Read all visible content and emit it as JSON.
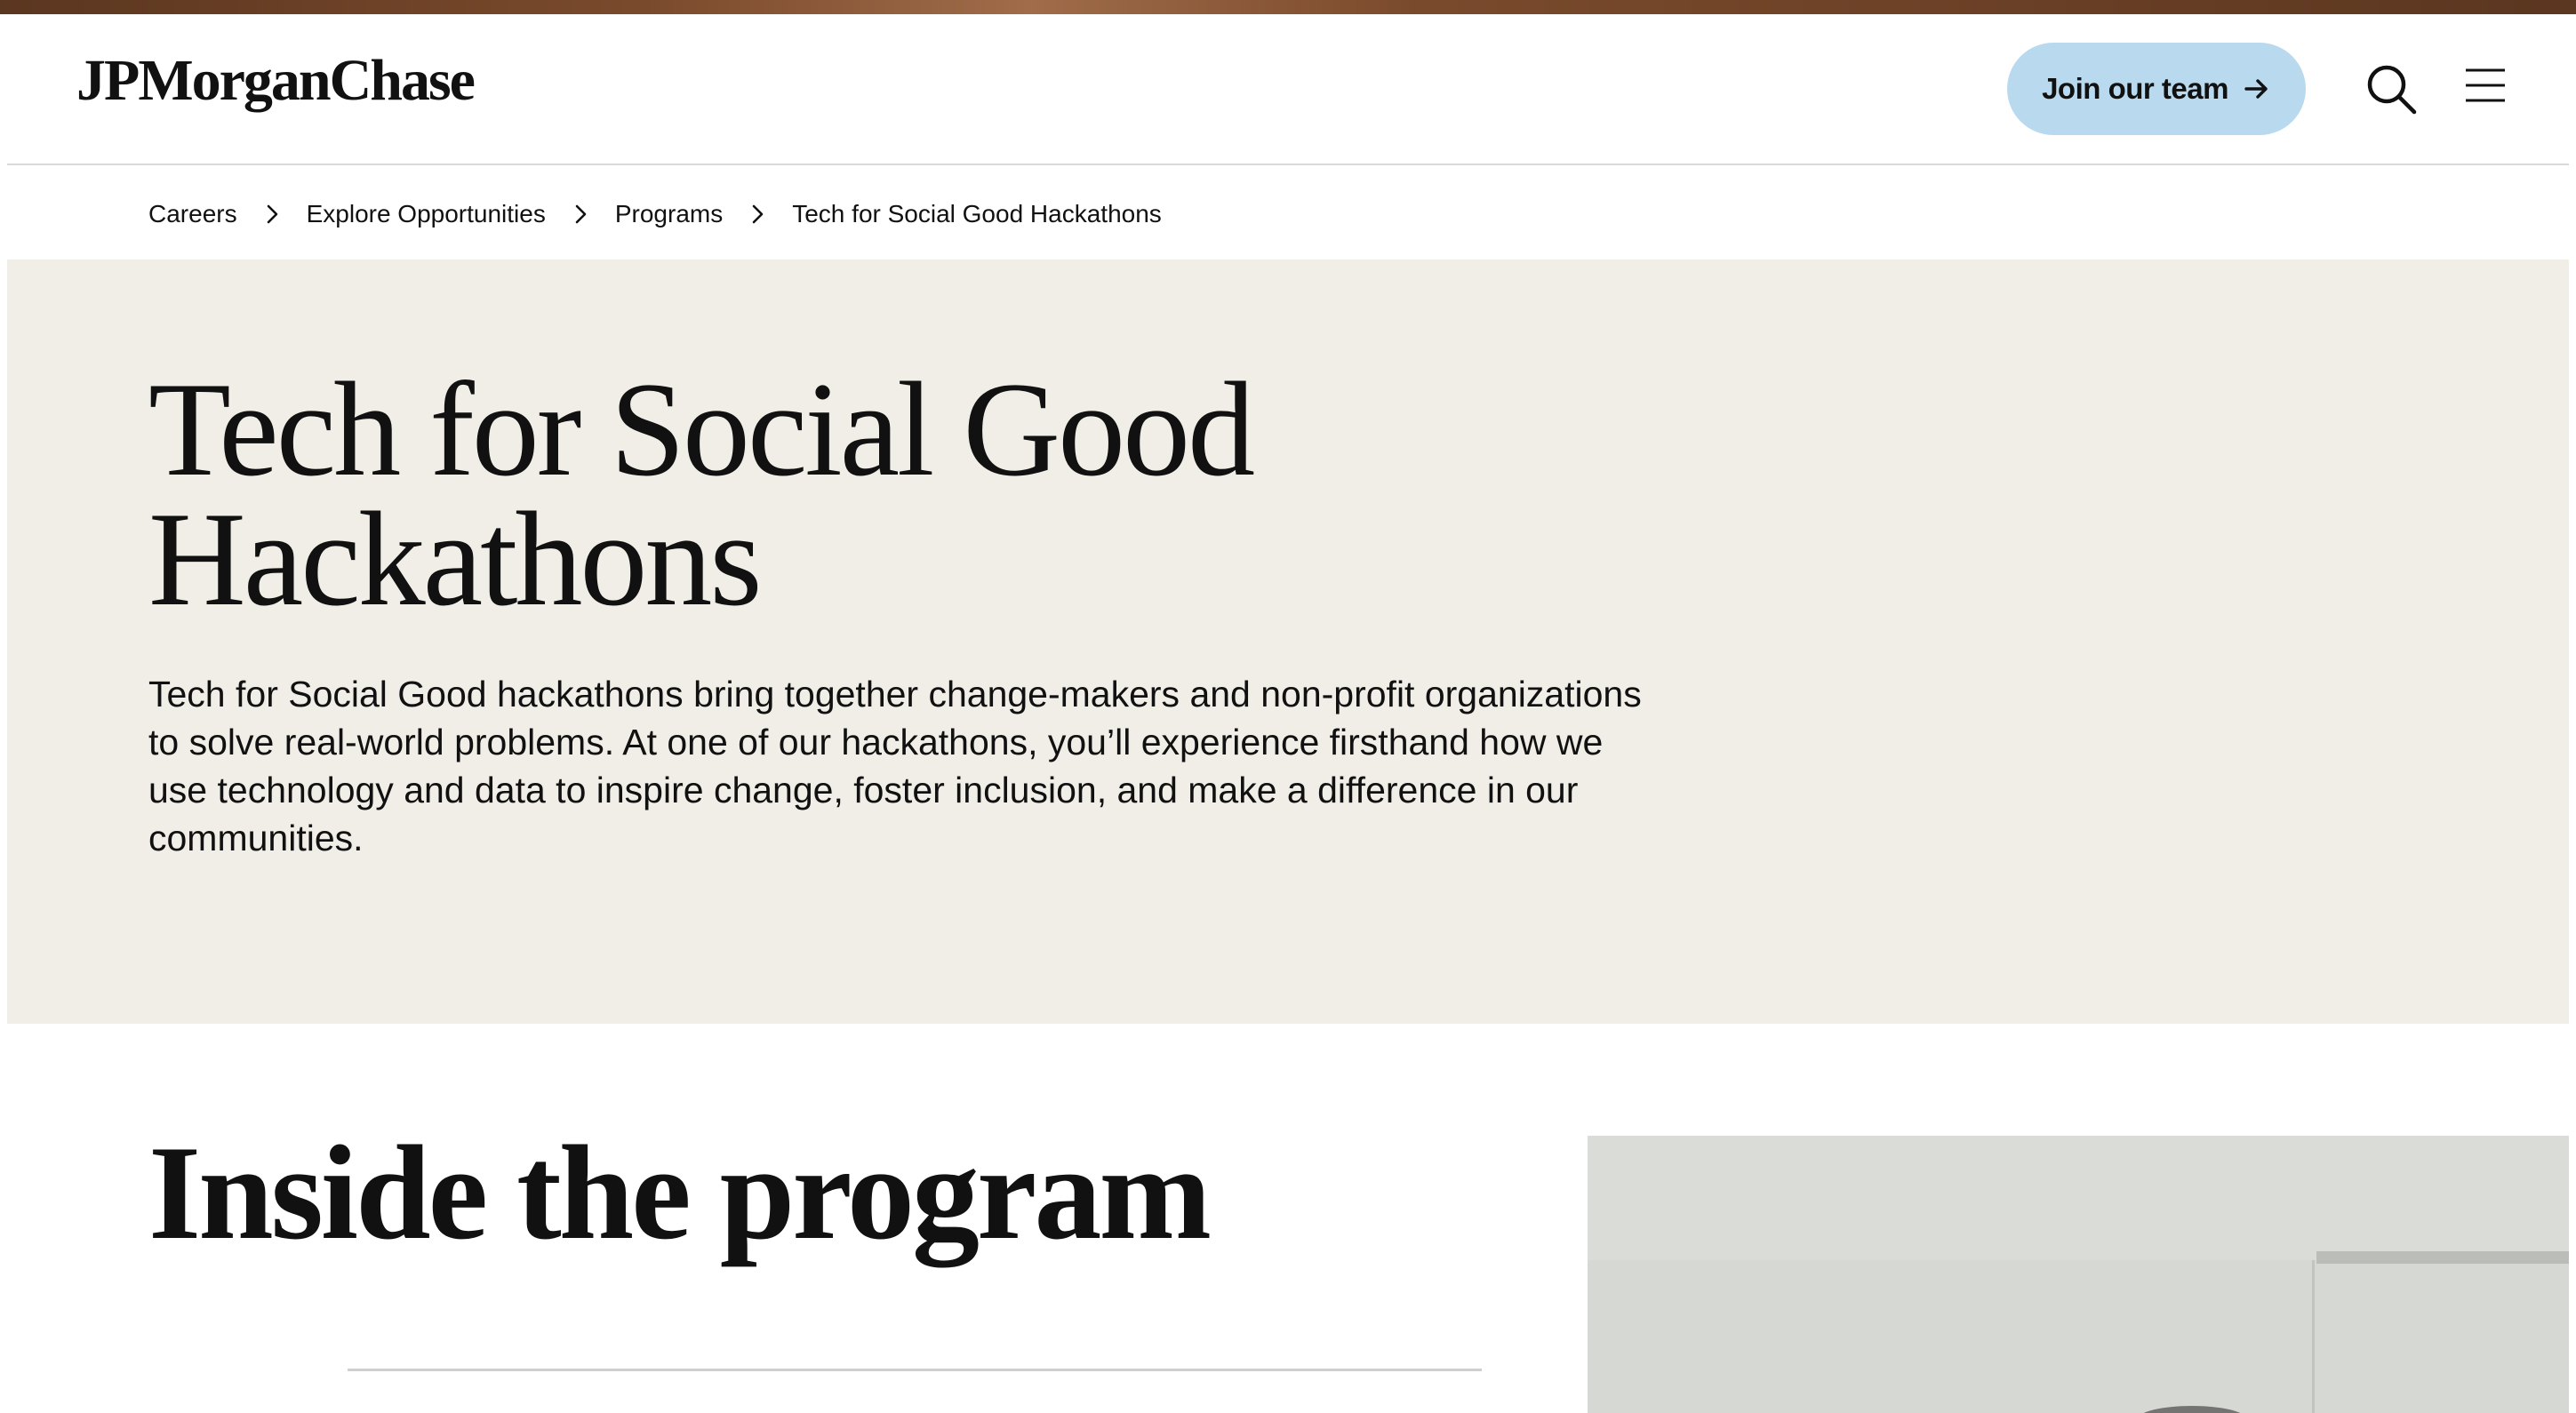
{
  "header": {
    "logo_text": "JPMorganChase",
    "join_label": "Join our team",
    "join_color": "#b9d9ef",
    "search_icon": "search-icon",
    "menu_icon": "hamburger-menu-icon"
  },
  "breadcrumb": {
    "items": [
      "Careers",
      "Explore Opportunities",
      "Programs",
      "Tech for Social Good Hackathons"
    ],
    "separator_icon": "chevron-right-icon"
  },
  "hero": {
    "title_line1": "Tech for Social Good",
    "title_line2": "Hackathons",
    "description": "Tech for Social Good hackathons bring together change-makers and non-profit organizations to solve real-world problems. At one of our hackathons, you’ll experience firsthand how we use technology and data to inspire change, foster inclusion, and make a difference in our communities.",
    "background_color": "#f1ede7"
  },
  "section": {
    "title": "Inside the program"
  },
  "colors": {
    "top_band": "#7a4a2c",
    "text": "#111111"
  }
}
